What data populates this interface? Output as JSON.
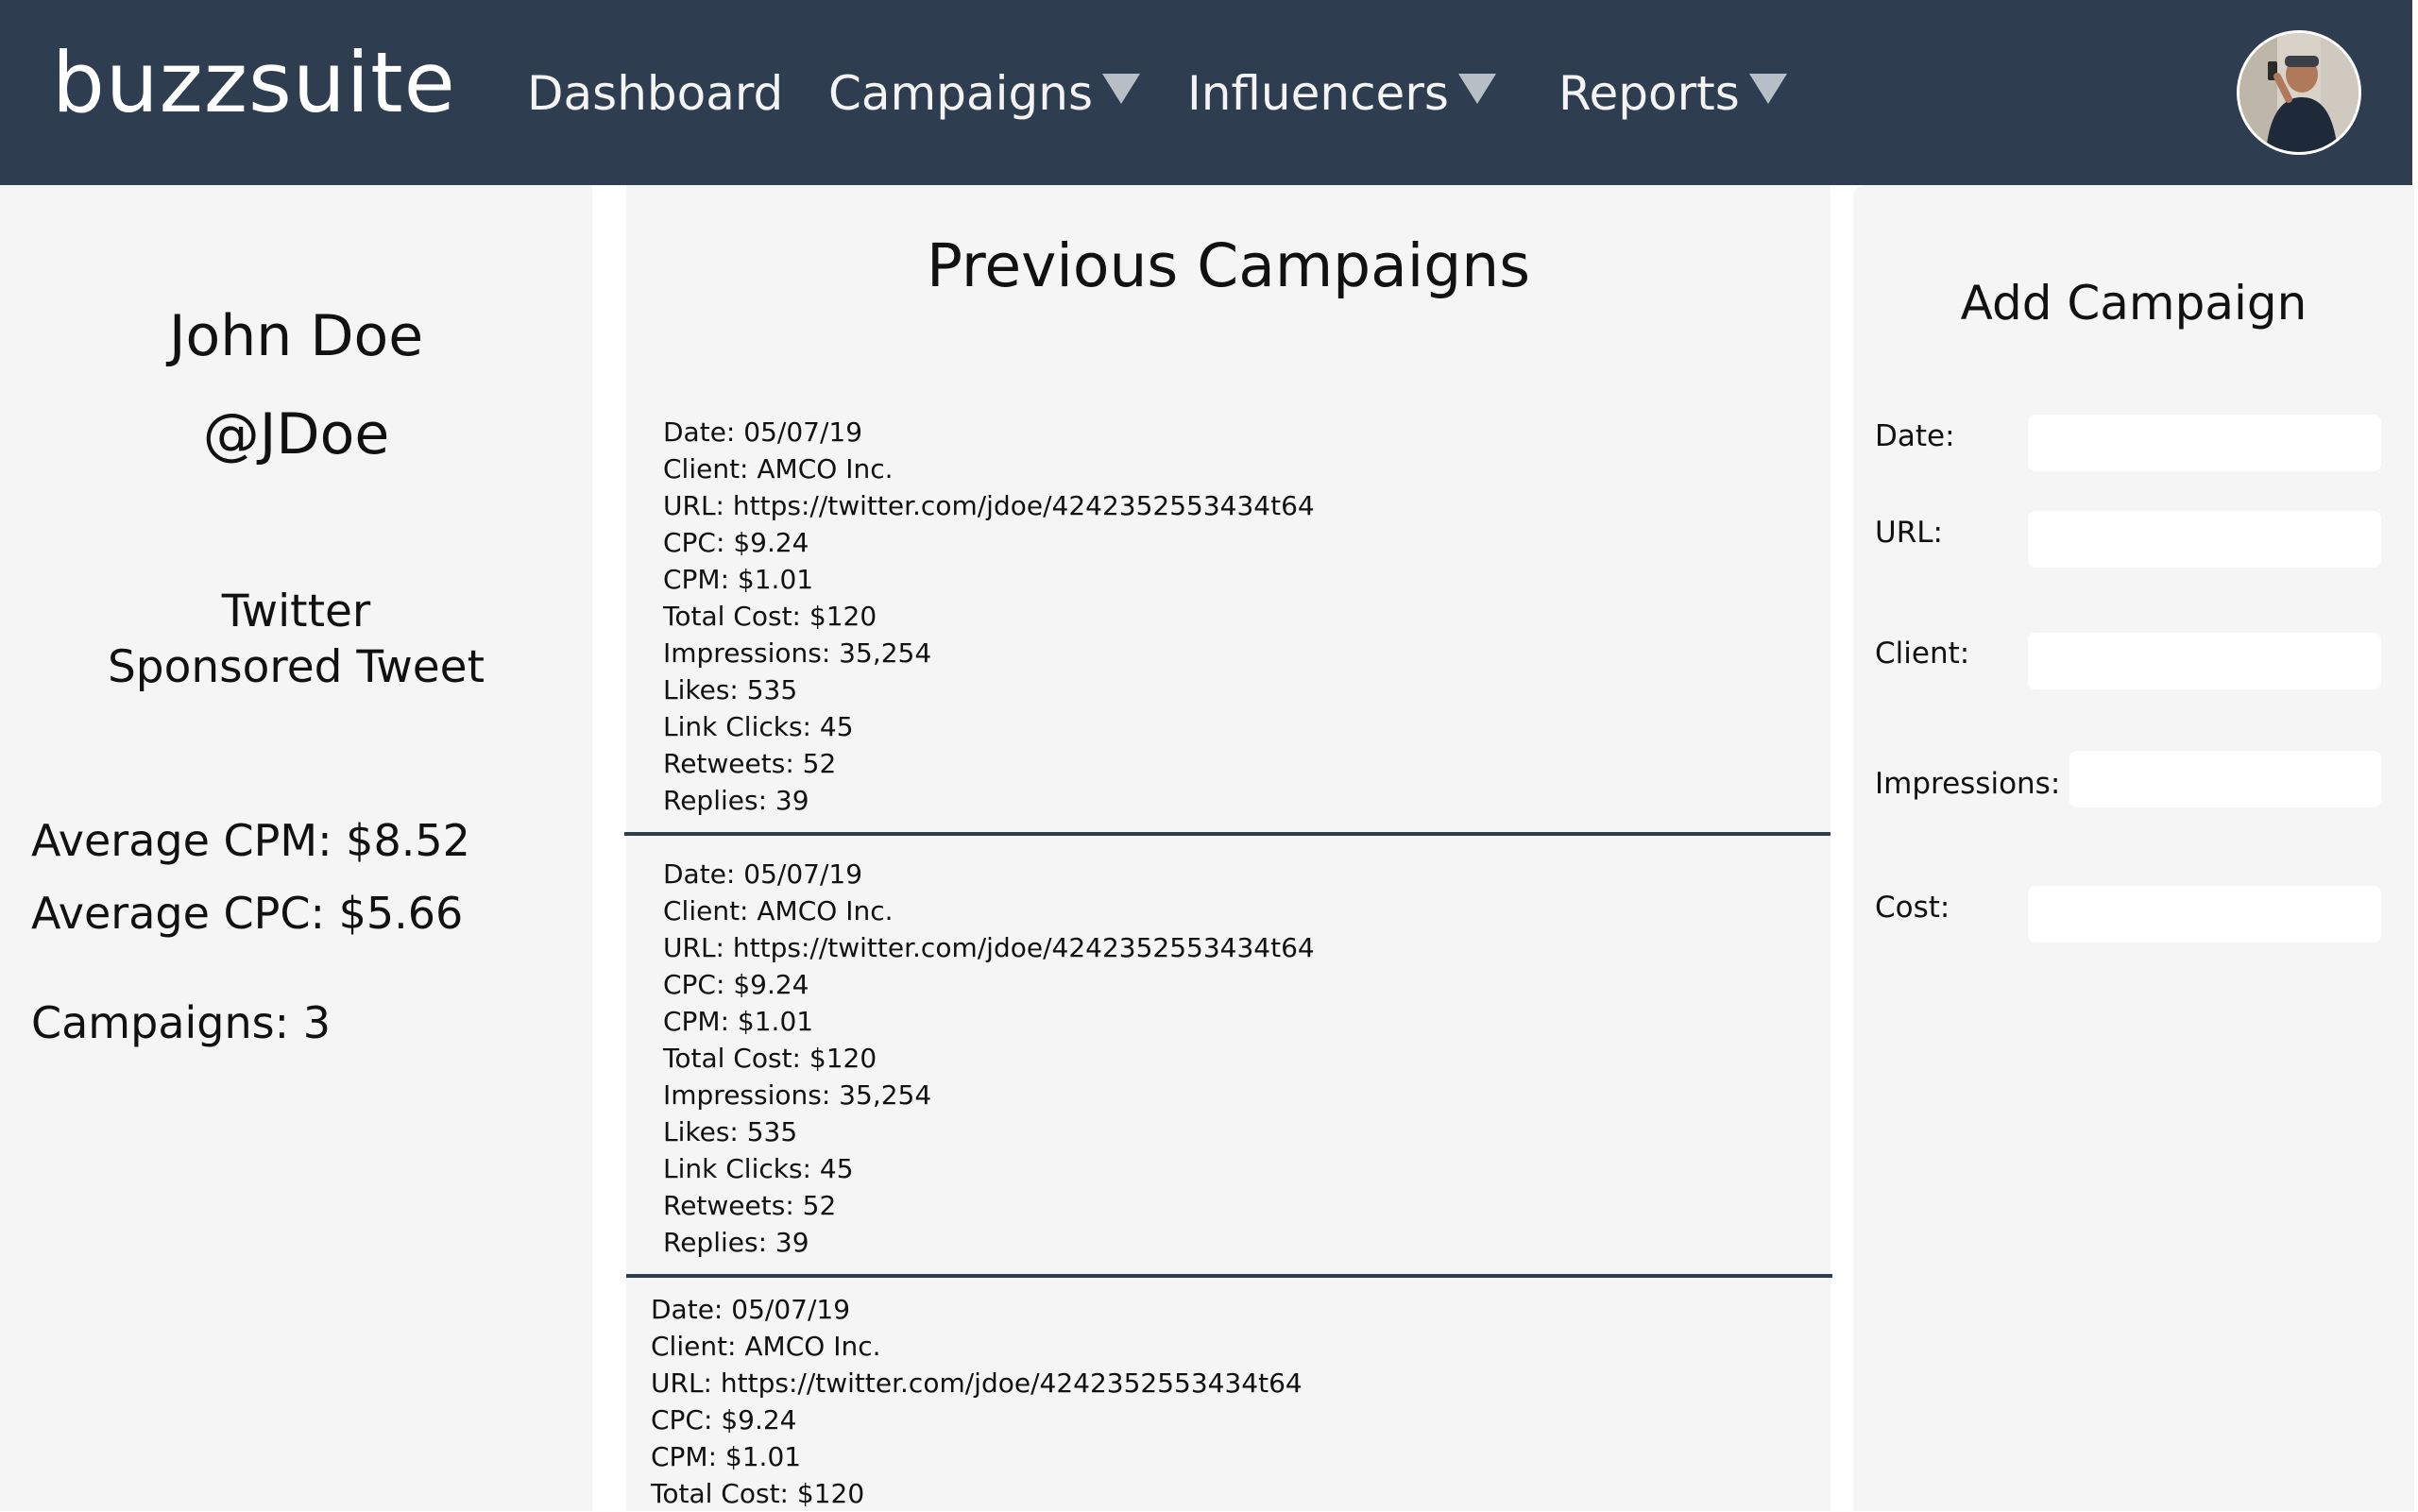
{
  "app": {
    "logo": "buzzsuite"
  },
  "nav": {
    "items": [
      {
        "label": "Dashboard"
      },
      {
        "label": "Campaigns"
      },
      {
        "label": "Influencers"
      },
      {
        "label": "Reports"
      }
    ]
  },
  "profile": {
    "name": "John Doe",
    "handle": "@JDoe",
    "platform": "Twitter",
    "format": "Sponsored Tweet",
    "avg_cpm": "Average CPM: $8.52",
    "avg_cpc": "Average CPC: $5.66",
    "campaigns": "Campaigns: 3"
  },
  "previous": {
    "title": "Previous Campaigns",
    "campaigns": [
      {
        "date": "Date: 05/07/19",
        "client": "Client: AMCO Inc.",
        "url": "URL: https://twitter.com/jdoe/4242352553434t64",
        "cpc": "CPC: $9.24",
        "cpm": "CPM: $1.01",
        "total_cost": "Total Cost: $120",
        "impressions": "Impressions: 35,254",
        "likes": "Likes: 535",
        "link_clicks": "Link Clicks: 45",
        "retweets": "Retweets: 52",
        "replies": "Replies: 39"
      },
      {
        "date": "Date: 05/07/19",
        "client": "Client: AMCO Inc.",
        "url": "URL: https://twitter.com/jdoe/4242352553434t64",
        "cpc": "CPC: $9.24",
        "cpm": "CPM: $1.01",
        "total_cost": "Total Cost: $120",
        "impressions": "Impressions: 35,254",
        "likes": "Likes: 535",
        "link_clicks": "Link Clicks: 45",
        "retweets": "Retweets: 52",
        "replies": "Replies: 39"
      },
      {
        "date": "Date: 05/07/19",
        "client": "Client: AMCO Inc.",
        "url": "URL: https://twitter.com/jdoe/4242352553434t64",
        "cpc": "CPC: $9.24",
        "cpm": "CPM: $1.01",
        "total_cost": "Total Cost: $120"
      }
    ]
  },
  "add_campaign": {
    "title": "Add Campaign",
    "fields": {
      "date": {
        "label": "Date:",
        "value": ""
      },
      "url": {
        "label": "URL:",
        "value": ""
      },
      "client": {
        "label": "Client:",
        "value": ""
      },
      "impressions": {
        "label": "Impressions:",
        "value": ""
      },
      "cost": {
        "label": "Cost:",
        "value": ""
      }
    }
  },
  "colors": {
    "header": "#2e3e50",
    "panel": "#f5f5f5",
    "divider": "#2e3e50"
  },
  "icons": {
    "avatar": "user-avatar-photo",
    "dropdown": "caret-down-icon"
  }
}
